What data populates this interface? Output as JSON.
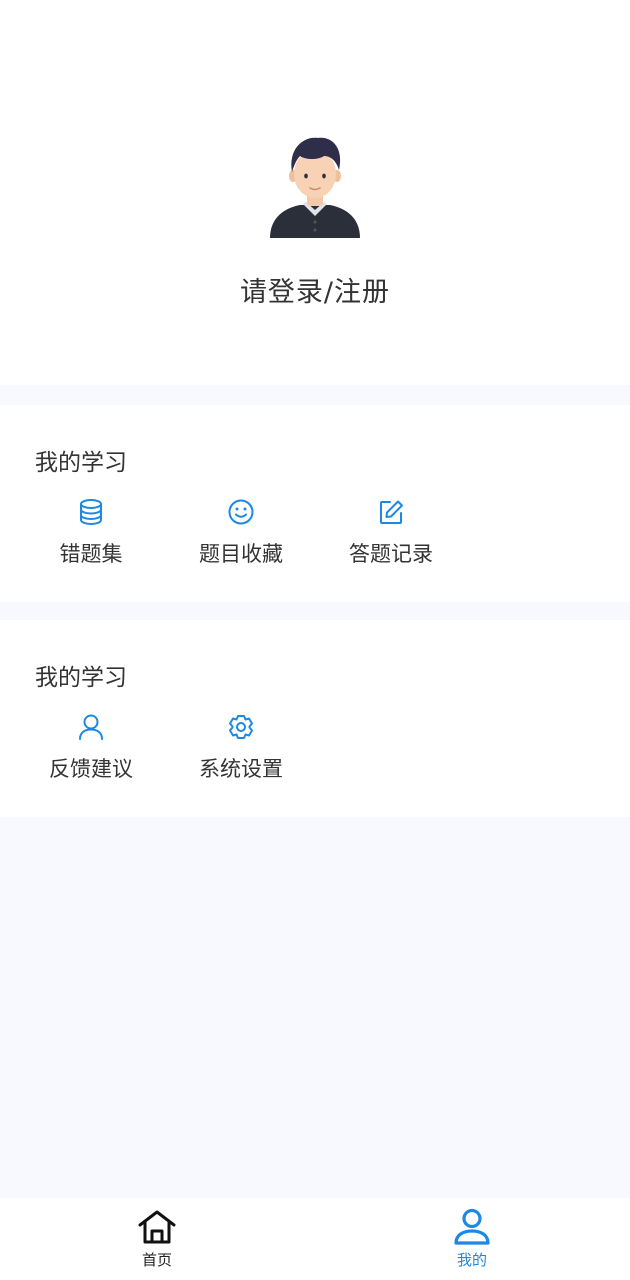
{
  "profile": {
    "login_label": "请登录/注册",
    "avatar_icon": "user-avatar-icon"
  },
  "study": {
    "title": "我的学习",
    "items": [
      {
        "label": "错题集",
        "icon": "database-icon"
      },
      {
        "label": "题目收藏",
        "icon": "smile-icon"
      },
      {
        "label": "答题记录",
        "icon": "edit-icon"
      }
    ]
  },
  "other": {
    "title": "我的学习",
    "items": [
      {
        "label": "反馈建议",
        "icon": "person-icon"
      },
      {
        "label": "系统设置",
        "icon": "settings-icon"
      }
    ]
  },
  "tabbar": {
    "items": [
      {
        "label": "首页",
        "icon": "home-icon",
        "active": false
      },
      {
        "label": "我的",
        "icon": "user-icon",
        "active": true
      }
    ]
  },
  "colors": {
    "accent": "#1e88e5",
    "background": "#f7f9fe",
    "card": "#ffffff",
    "text": "#333333"
  }
}
